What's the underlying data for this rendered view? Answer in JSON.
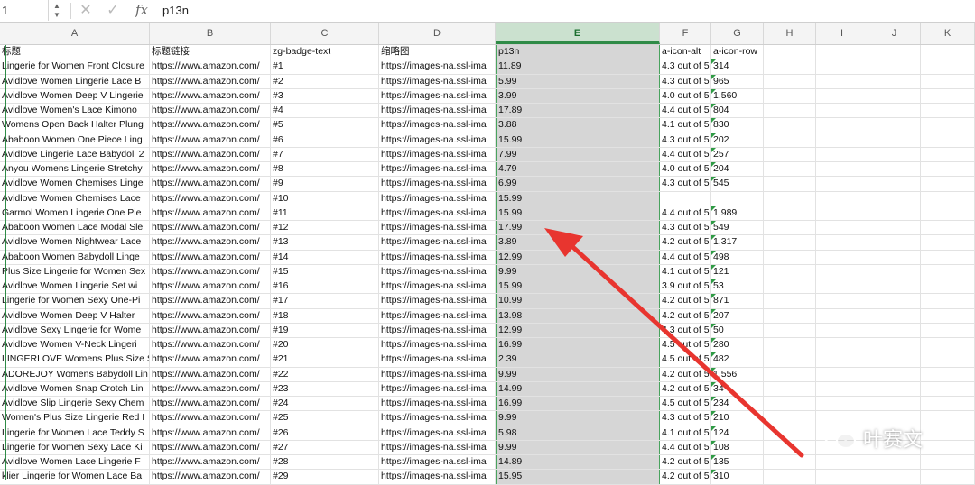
{
  "formula_bar": {
    "cell_ref": "1",
    "cancel_icon": "✕",
    "confirm_icon": "✓",
    "fx_label": "fx",
    "formula": "p13n"
  },
  "columns": [
    {
      "letter": "A",
      "header": "标题"
    },
    {
      "letter": "B",
      "header": "标题链接"
    },
    {
      "letter": "C",
      "header": "zg-badge-text"
    },
    {
      "letter": "D",
      "header": "缩略图"
    },
    {
      "letter": "E",
      "header": "p13n"
    },
    {
      "letter": "F",
      "header": "a-icon-alt"
    },
    {
      "letter": "G",
      "header": "a-icon-row"
    },
    {
      "letter": "H",
      "header": ""
    },
    {
      "letter": "I",
      "header": ""
    },
    {
      "letter": "J",
      "header": ""
    },
    {
      "letter": "K",
      "header": ""
    }
  ],
  "selected_column": "E",
  "rows": [
    [
      "Lingerie for Women Front Closure",
      "https://www.amazon.com/",
      "#1",
      "https://images-na.ssl-ima",
      "11.89",
      "4.3 out of 5",
      "314"
    ],
    [
      "Avidlove Women Lingerie Lace B",
      "https://www.amazon.com/",
      "#2",
      "https://images-na.ssl-ima",
      "5.99",
      "4.3 out of 5",
      "965"
    ],
    [
      "Avidlove Women Deep V Lingerie",
      "https://www.amazon.com/",
      "#3",
      "https://images-na.ssl-ima",
      "3.99",
      "4.0 out of 5",
      "1,560"
    ],
    [
      "Avidlove Women's Lace Kimono",
      "https://www.amazon.com/",
      "#4",
      "https://images-na.ssl-ima",
      "17.89",
      "4.4 out of 5",
      "804"
    ],
    [
      "Womens Open Back Halter Plung",
      "https://www.amazon.com/",
      "#5",
      "https://images-na.ssl-ima",
      "3.88",
      "4.1 out of 5",
      "830"
    ],
    [
      "Ababoon Women One Piece Ling",
      "https://www.amazon.com/",
      "#6",
      "https://images-na.ssl-ima",
      "15.99",
      "4.3 out of 5",
      "202"
    ],
    [
      "Avidlove Lingerie Lace Babydoll 2",
      "https://www.amazon.com/",
      "#7",
      "https://images-na.ssl-ima",
      "7.99",
      "4.4 out of 5",
      "257"
    ],
    [
      "Anyou Womens Lingerie Stretchy",
      "https://www.amazon.com/",
      "#8",
      "https://images-na.ssl-ima",
      "4.79",
      "4.0 out of 5",
      "204"
    ],
    [
      "Avidlove Women Chemises Linge",
      "https://www.amazon.com/",
      "#9",
      "https://images-na.ssl-ima",
      "6.99",
      "4.3 out of 5",
      "545"
    ],
    [
      "Avidlove Women Chemises Lace",
      "https://www.amazon.com/",
      "#10",
      "https://images-na.ssl-ima",
      "15.99",
      "",
      ""
    ],
    [
      "Garmol Women Lingerie One Pie",
      "https://www.amazon.com/",
      "#11",
      "https://images-na.ssl-ima",
      "15.99",
      "4.4 out of 5",
      "1,989"
    ],
    [
      "Ababoon Women Lace Modal Sle",
      "https://www.amazon.com/",
      "#12",
      "https://images-na.ssl-ima",
      "17.99",
      "4.3 out of 5",
      "549"
    ],
    [
      "Avidlove Women Nightwear Lace",
      "https://www.amazon.com/",
      "#13",
      "https://images-na.ssl-ima",
      "3.89",
      "4.2 out of 5",
      "1,317"
    ],
    [
      "Ababoon Women Babydoll Linge",
      "https://www.amazon.com/",
      "#14",
      "https://images-na.ssl-ima",
      "12.99",
      "4.4 out of 5",
      "498"
    ],
    [
      "Plus Size Lingerie for Women Sex",
      "https://www.amazon.com/",
      "#15",
      "https://images-na.ssl-ima",
      "9.99",
      "4.1 out of 5",
      "121"
    ],
    [
      "Avidlove Women Lingerie Set wi",
      "https://www.amazon.com/",
      "#16",
      "https://images-na.ssl-ima",
      "15.99",
      "3.9 out of 5",
      "53"
    ],
    [
      "Lingerie for Women Sexy One-Pi",
      "https://www.amazon.com/",
      "#17",
      "https://images-na.ssl-ima",
      "10.99",
      "4.2 out of 5",
      "871"
    ],
    [
      "Avidlove Women Deep V Halter",
      "https://www.amazon.com/",
      "#18",
      "https://images-na.ssl-ima",
      "13.98",
      "4.2 out of 5",
      "207"
    ],
    [
      "Avidlove Sexy Lingerie for Wome",
      "https://www.amazon.com/",
      "#19",
      "https://images-na.ssl-ima",
      "12.99",
      "4.3 out of 5",
      "50"
    ],
    [
      "Avidlove Women V-Neck Lingeri",
      "https://www.amazon.com/",
      "#20",
      "https://images-na.ssl-ima",
      "16.99",
      "4.5 out of 5",
      "280"
    ],
    [
      "LINGERLOVE Womens Plus Size S",
      "https://www.amazon.com/",
      "#21",
      "https://images-na.ssl-ima",
      "2.39",
      "4.5 out of 5",
      "482"
    ],
    [
      "ADOREJOY Womens Babydoll Lin",
      "https://www.amazon.com/",
      "#22",
      "https://images-na.ssl-ima",
      "9.99",
      "4.2 out of 5",
      "1,556"
    ],
    [
      "Avidlove Women Snap Crotch Lin",
      "https://www.amazon.com/",
      "#23",
      "https://images-na.ssl-ima",
      "14.99",
      "4.2 out of 5",
      "34"
    ],
    [
      "Avidlove Slip Lingerie Sexy Chem",
      "https://www.amazon.com/",
      "#24",
      "https://images-na.ssl-ima",
      "16.99",
      "4.5 out of 5",
      "234"
    ],
    [
      "Women's Plus Size Lingerie Red I",
      "https://www.amazon.com/",
      "#25",
      "https://images-na.ssl-ima",
      "9.99",
      "4.3 out of 5",
      "210"
    ],
    [
      "Lingerie for Women Lace Teddy S",
      "https://www.amazon.com/",
      "#26",
      "https://images-na.ssl-ima",
      "5.98",
      "4.1 out of 5",
      "124"
    ],
    [
      "Lingerie for Women Sexy Lace Ki",
      "https://www.amazon.com/",
      "#27",
      "https://images-na.ssl-ima",
      "9.99",
      "4.4 out of 5",
      "108"
    ],
    [
      "Avidlove Women Lace Lingerie F",
      "https://www.amazon.com/",
      "#28",
      "https://images-na.ssl-ima",
      "14.89",
      "4.2 out of 5",
      "135"
    ],
    [
      "klier Lingerie for Women Lace Ba",
      "https://www.amazon.com/",
      "#29",
      "https://images-na.ssl-ima",
      "15.95",
      "4.2 out of 5",
      "310"
    ]
  ],
  "watermark": {
    "text": "叶赛文",
    "logo_icon": "wechat-logo-icon"
  },
  "annotation": {
    "arrow_color": "#e8352f"
  }
}
